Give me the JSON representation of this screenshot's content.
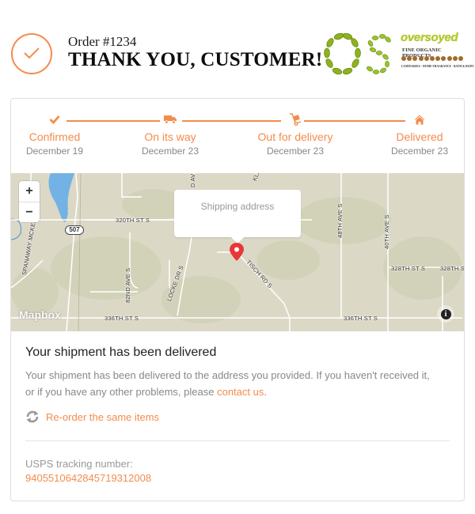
{
  "header": {
    "order_number": "Order #1234",
    "title": "THANK YOU, CUSTOMER!"
  },
  "logo": {
    "brand": "oversoyed",
    "subtitle": "FINE ORGANIC PRODUCTS",
    "tagline": "LUMINARIES · HOME FRAGRANCE · BATH & BODY"
  },
  "colors": {
    "accent": "#f48b4c",
    "pin": "#e8373a",
    "water": "#73b2e5",
    "map_bg": "#dcd8c6"
  },
  "steps": [
    {
      "icon": "check-icon",
      "label": "Confirmed",
      "date": "December 19"
    },
    {
      "icon": "truck-icon",
      "label": "On its way",
      "date": "December 23"
    },
    {
      "icon": "dolly-icon",
      "label": "Out for delivery",
      "date": "December 23"
    },
    {
      "icon": "home-icon",
      "label": "Delivered",
      "date": "December 23"
    }
  ],
  "map": {
    "zoom_in": "+",
    "zoom_out": "−",
    "popup": "Shipping address",
    "attribution": "Mapbox",
    "info": "i",
    "labels": {
      "st320": "320TH ST S",
      "st328a": "328TH ST S",
      "st328b": "328TH S",
      "st336a": "336TH ST S",
      "st336b": "336TH ST S",
      "hwy": "SPANAWAY MCKENNA HWY",
      "ave82": "82ND AVE S",
      "locke": "LOCKE DR S",
      "tisch": "TISCH RD S",
      "ave48": "48TH AVE S",
      "ave40": "40TH AVE S",
      "route": "507",
      "d_ave": "D AVE",
      "kle": "KLE"
    }
  },
  "status": {
    "heading": "Your shipment has been delivered",
    "description": "Your shipment has been delivered to the address you provided. If you haven't received it, or if you have any other problems, please ",
    "contact_link": "contact us",
    "description_end": ".",
    "reorder": "Re-order the same items"
  },
  "tracking": {
    "label": "USPS tracking number:",
    "number": "9405510642845719312008"
  }
}
